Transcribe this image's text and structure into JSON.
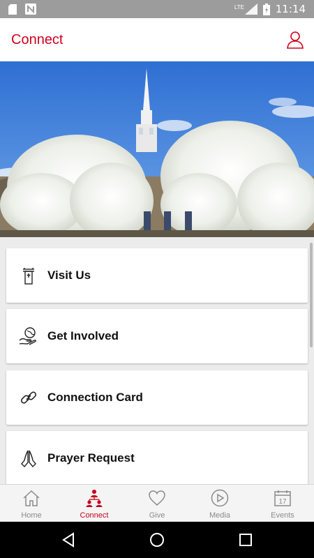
{
  "status_bar": {
    "network_label": "LTE",
    "time": "11:14"
  },
  "header": {
    "title": "Connect",
    "accent_color": "#d0021b"
  },
  "hero": {
    "description_icon": "church-steeple-blossom-image"
  },
  "cards": [
    {
      "label": "Visit Us",
      "icon": "steeple-icon"
    },
    {
      "label": "Get Involved",
      "icon": "hand-globe-icon"
    },
    {
      "label": "Connection Card",
      "icon": "link-icon"
    },
    {
      "label": "Prayer Request",
      "icon": "praying-hands-icon"
    }
  ],
  "tabs": [
    {
      "label": "Home",
      "icon": "home-icon",
      "active": false
    },
    {
      "label": "Connect",
      "icon": "people-icon",
      "active": true
    },
    {
      "label": "Give",
      "icon": "heart-icon",
      "active": false
    },
    {
      "label": "Media",
      "icon": "play-icon",
      "active": false
    },
    {
      "label": "Events",
      "icon": "calendar-icon",
      "active": false,
      "badge": "17"
    }
  ],
  "colors": {
    "active_tab": "#c4001a",
    "inactive_tab": "#8a8a8a",
    "status_bar": "#9c9c9c"
  }
}
